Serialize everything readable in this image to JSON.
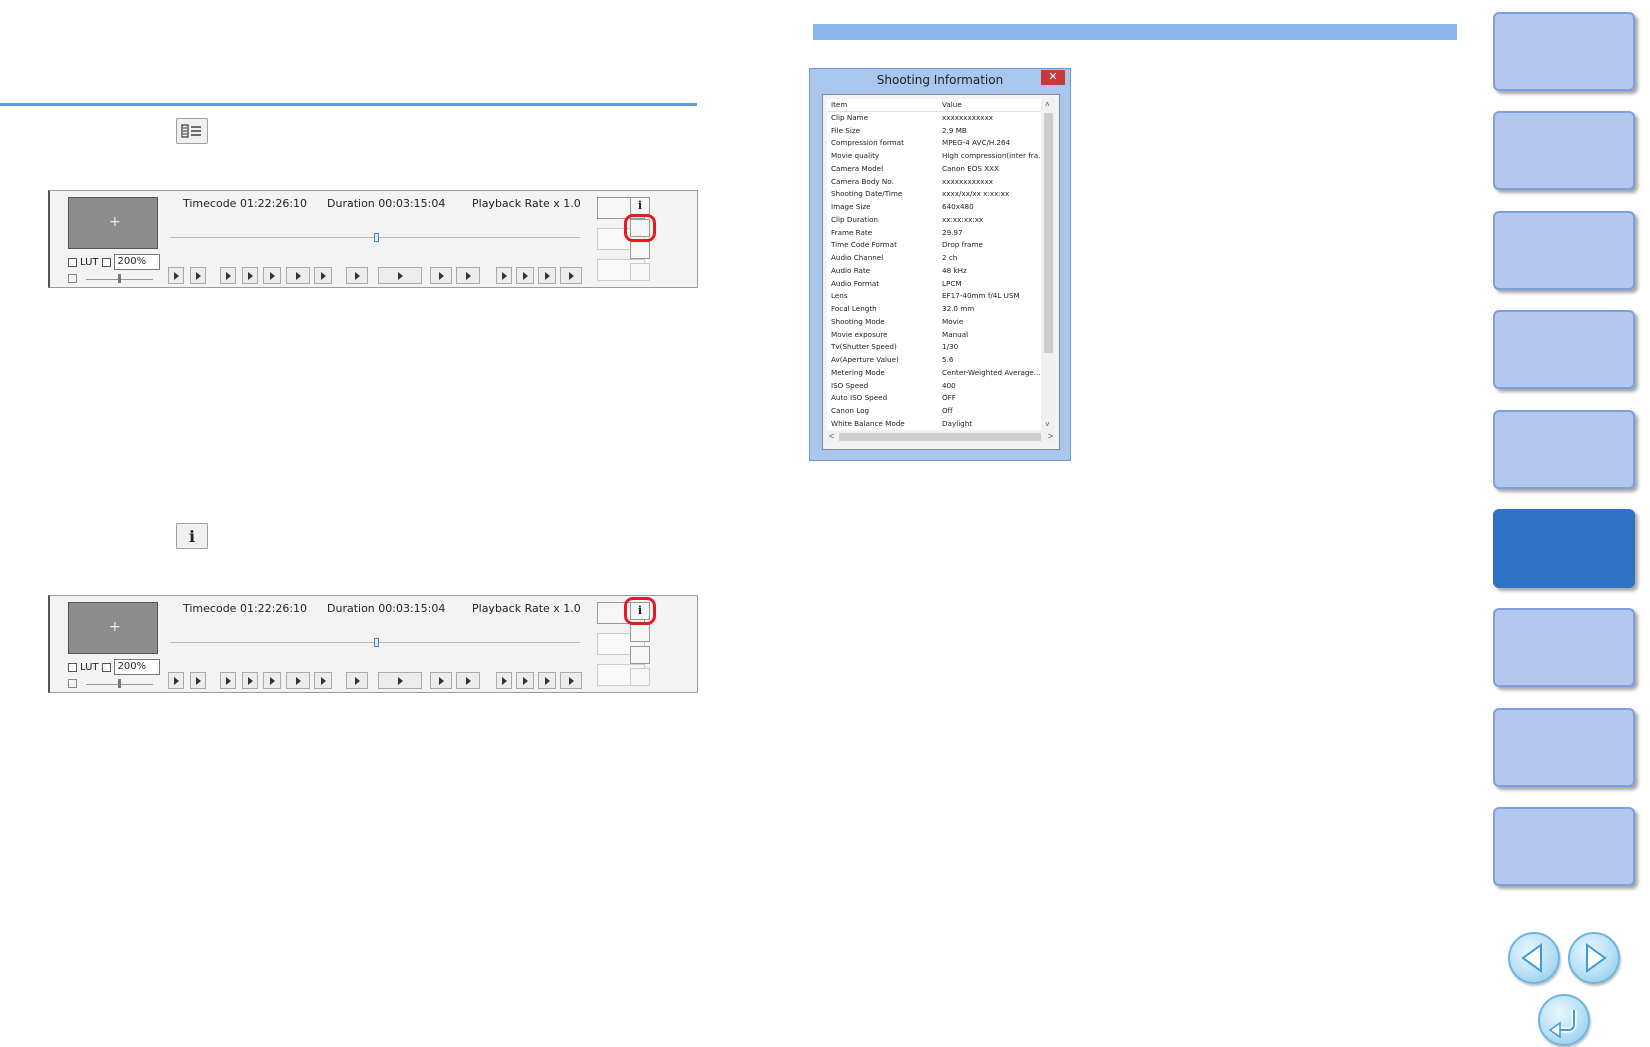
{
  "player": {
    "timecode": "Timecode 01:22:26:10",
    "duration": "Duration 00:03:15:04",
    "playback_rate": "Playback Rate x 1.0",
    "lut_label": "LUT",
    "zoom": "200%"
  },
  "info_icon_glyph": "i",
  "dialog": {
    "title": "Shooting Information",
    "close_glyph": "✕",
    "columns": [
      "Item",
      "Value"
    ],
    "rows": [
      [
        "Clip Name",
        "xxxxxxxxxxxx"
      ],
      [
        "File Size",
        "2.9 MB"
      ],
      [
        "Compression format",
        "MPEG-4 AVC/H.264"
      ],
      [
        "Movie quality",
        "High compression(inter fra..."
      ],
      [
        "Camera Model",
        "Canon EOS XXX"
      ],
      [
        "Camera Body No.",
        "xxxxxxxxxxxx"
      ],
      [
        "Shooting Date/Time",
        "xxxx/xx/xx  x:xx:xx"
      ],
      [
        "Image Size",
        "640x480"
      ],
      [
        "Clip Duration",
        "xx:xx:xx:xx"
      ],
      [
        "Frame Rate",
        "29.97"
      ],
      [
        "Time Code Format",
        "Drop frame"
      ],
      [
        "Audio Channel",
        "2 ch"
      ],
      [
        "Audio Rate",
        "48 kHz"
      ],
      [
        "Audio Format",
        "LPCM"
      ],
      [
        "Lens",
        "EF17-40mm f/4L USM"
      ],
      [
        "Focal Length",
        "32.0 mm"
      ],
      [
        "Shooting Mode",
        "Movie"
      ],
      [
        "Movie exposure",
        "Manual"
      ],
      [
        "Tv(Shutter Speed)",
        "1/30"
      ],
      [
        "Av(Aperture Value)",
        "5.6"
      ],
      [
        "Metering Mode",
        "Center-Weighted Average..."
      ],
      [
        "ISO Speed",
        "400"
      ],
      [
        "Auto ISO Speed",
        "OFF"
      ],
      [
        "Canon Log",
        "Off"
      ],
      [
        "White Balance Mode",
        "Daylight"
      ]
    ]
  },
  "colors": {
    "accent_rule": "#5b9bd5",
    "tab": "#b4c7ef",
    "tab_active": "#2e72c4",
    "highlight": "#e31b23"
  },
  "sidebar": {
    "tab_count": 9,
    "active_tab_index": 5
  },
  "nav": {
    "prev_icon": "arrow-left-icon",
    "next_icon": "arrow-right-icon",
    "back_icon": "return-icon"
  }
}
